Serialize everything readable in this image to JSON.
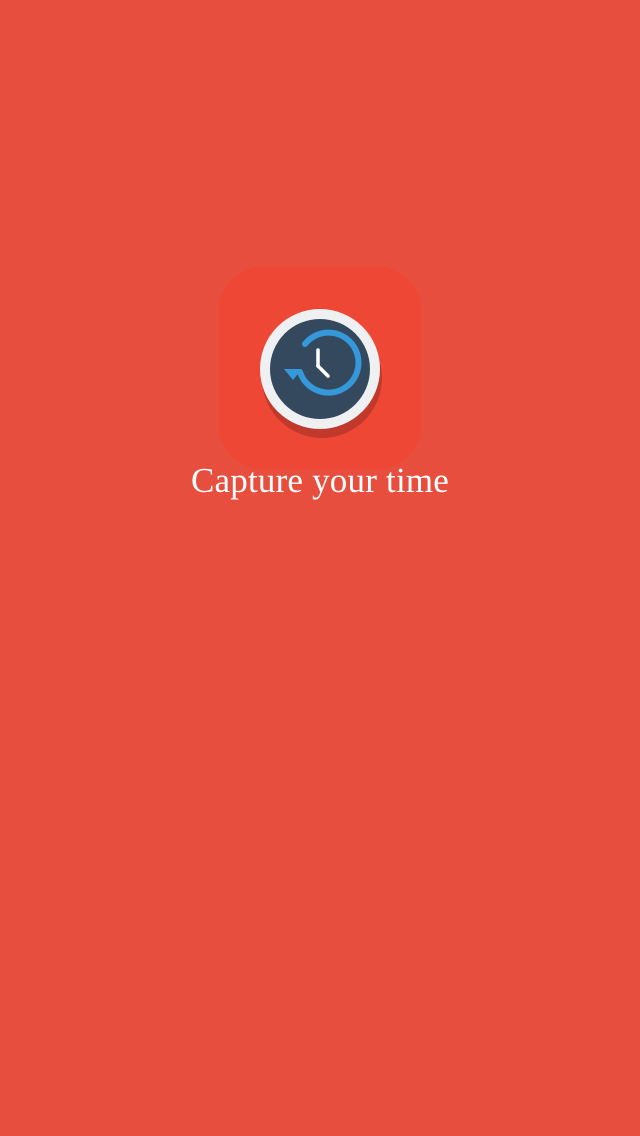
{
  "splash": {
    "tagline": "Capture your time",
    "icon": "clock-history-icon"
  },
  "colors": {
    "background": "#e74e3d",
    "icon_tile": "#ee4736",
    "icon_ring": "#eef0f2",
    "icon_face": "#34495e",
    "icon_arrow": "#3498db",
    "icon_shadow": "#c0392b"
  }
}
